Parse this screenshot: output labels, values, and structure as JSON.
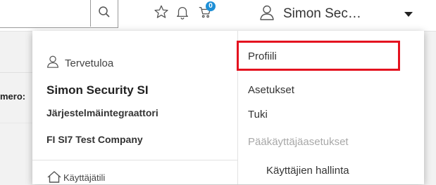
{
  "header": {
    "search_icon": "search-icon",
    "favorites_icon": "star-icon",
    "notifications_icon": "bell-icon",
    "cart_icon": "cart-icon",
    "cart_count": "0",
    "user_icon": "user-icon",
    "user_display_name": "Simon Sec…",
    "caret_icon": "caret-down-icon",
    "accent_color": "#1e8fd6"
  },
  "background": {
    "partial_label": "mero:"
  },
  "dropdown": {
    "left": {
      "welcome_icon": "user-icon",
      "welcome_text": "Tervetuloa",
      "full_name": "Simon Security SI",
      "role": "Järjestelmäintegraattori",
      "company": "FI SI7 Test Company",
      "account_icon": "home-icon",
      "account_link": "Käyttäjätili"
    },
    "right": {
      "items": [
        {
          "label": "Profiili",
          "highlighted": true
        },
        {
          "label": "Asetukset"
        },
        {
          "label": "Tuki"
        }
      ],
      "admin_section_header": "Pääkäyttäjäasetukset",
      "admin_items": [
        {
          "label": "Käyttäjien hallinta"
        }
      ],
      "highlight_color": "#e4121f"
    }
  }
}
